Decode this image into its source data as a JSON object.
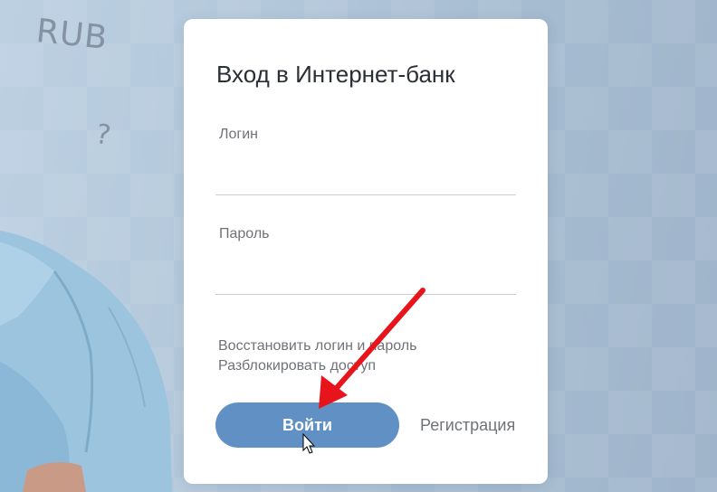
{
  "decor": {
    "currency_text": "RUB",
    "question_mark": "?"
  },
  "login_form": {
    "title": "Вход в Интернет-банк",
    "login_label": "Логин",
    "login_value": "",
    "password_label": "Пароль",
    "password_value": "",
    "recover_link": "Восстановить логин и пароль",
    "unlock_link": "Разблокировать доступ",
    "submit_button": "Войти",
    "register_link": "Регистрация"
  },
  "colors": {
    "primary_button": "#6191c4",
    "annotation_arrow": "#e8141c",
    "background": "#b3c7da"
  },
  "icons": {
    "annotation": "red-arrow-icon",
    "cursor": "mouse-pointer-icon"
  }
}
